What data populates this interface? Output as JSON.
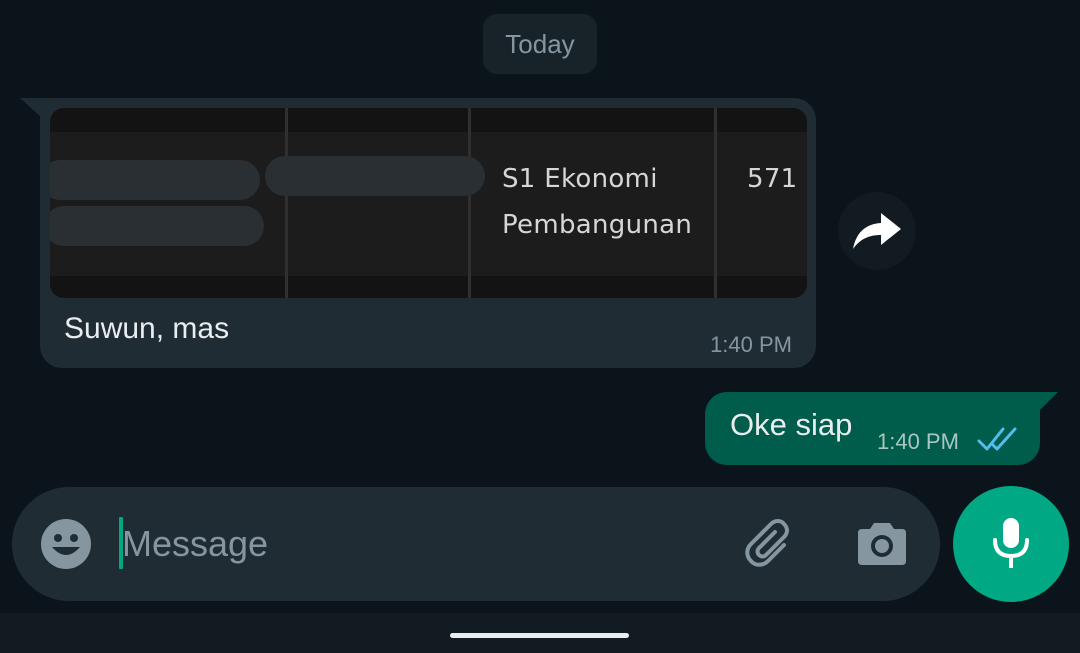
{
  "date_separator": "Today",
  "incoming_message": {
    "image_preview": {
      "row": [
        "S1 Ekonomi",
        "Pembangunan",
        "571"
      ]
    },
    "text": "Suwun, mas",
    "time": "1:40 PM"
  },
  "outgoing_message": {
    "text": "Oke siap",
    "time": "1:40 PM",
    "status": "read"
  },
  "composer": {
    "placeholder": "Message",
    "value": ""
  },
  "icons": {
    "forward": "forward-icon",
    "emoji": "emoji-icon",
    "attach": "paperclip-icon",
    "camera": "camera-icon",
    "mic": "microphone-icon",
    "ticks": "double-check-icon"
  },
  "colors": {
    "background": "#0b141a",
    "incoming_bubble": "#202c33",
    "outgoing_bubble": "#005c4b",
    "accent": "#00a884",
    "read_ticks": "#53bdeb"
  }
}
